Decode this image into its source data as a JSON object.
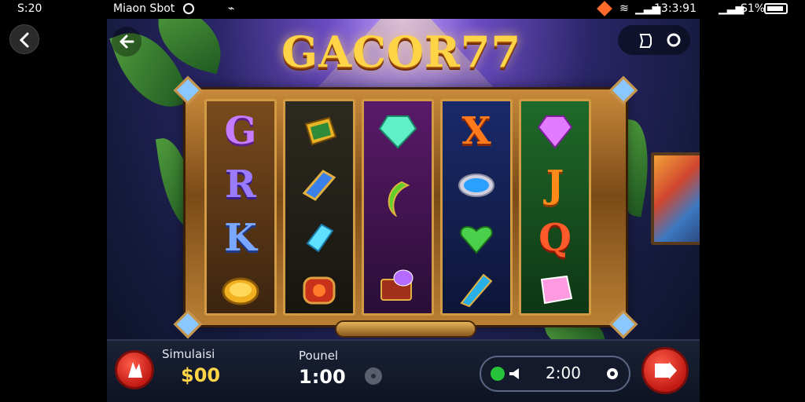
{
  "status_bar": {
    "time": "S:20",
    "app_label": "Miaon Sbot",
    "right_clock": "13:3:91",
    "signal": "S1%"
  },
  "game": {
    "title": "GACOR77",
    "reels": [
      [
        {
          "type": "letter",
          "text": "G",
          "color": "#c77bff"
        },
        {
          "type": "letter",
          "text": "R",
          "color": "#9b7bff"
        },
        {
          "type": "letter",
          "text": "K",
          "color": "#7aa7ff"
        },
        {
          "type": "icon",
          "icon": "gold-coin-icon"
        }
      ],
      [
        {
          "type": "icon",
          "icon": "gold-bar-icon"
        },
        {
          "type": "icon",
          "icon": "blue-bar-icon"
        },
        {
          "type": "icon",
          "icon": "cyan-gem-icon"
        },
        {
          "type": "icon",
          "icon": "red-ring-icon"
        }
      ],
      [
        {
          "type": "icon",
          "icon": "green-gem-icon"
        },
        {
          "type": "icon",
          "icon": "green-crescent-icon"
        },
        {
          "type": "icon",
          "icon": "treasure-chest-icon"
        }
      ],
      [
        {
          "type": "letter",
          "text": "X",
          "color": "#ff7a1a"
        },
        {
          "type": "icon",
          "icon": "blue-ring-icon"
        },
        {
          "type": "icon",
          "icon": "green-heart-icon"
        },
        {
          "type": "icon",
          "icon": "blue-crystal-icon"
        }
      ],
      [
        {
          "type": "icon",
          "icon": "purple-gem-icon"
        },
        {
          "type": "letter",
          "text": "J",
          "color": "#ff8a1a"
        },
        {
          "type": "letter",
          "text": "Q",
          "color": "#ff5a2a"
        },
        {
          "type": "icon",
          "icon": "pink-crystal-icon"
        }
      ]
    ]
  },
  "bottom": {
    "sim_label": "Simulaisi",
    "sim_value": "$00",
    "pound_label": "Pounel",
    "pound_value": "1:00",
    "auto_value": "2:00"
  },
  "colors": {
    "accent_gold": "#ffd447",
    "spin_red": "#d4221a",
    "panel_dark": "#141a2b"
  }
}
